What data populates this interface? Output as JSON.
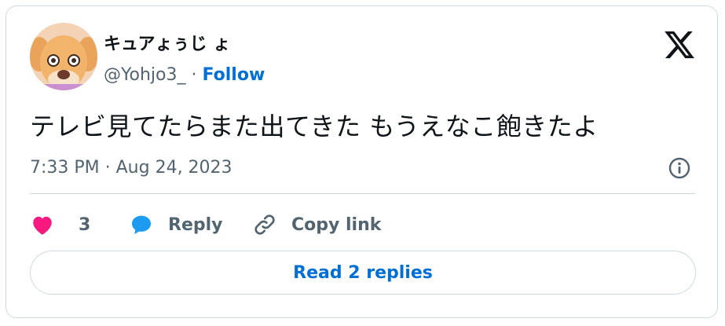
{
  "author": {
    "display_name": "キュアょぅじ ょ",
    "handle": "@Yohjo3_",
    "separator": "·",
    "follow_label": "Follow"
  },
  "tweet": {
    "text": "テレビ見てたらまた出てきた もうえなこ飽きたよ",
    "timestamp": "7:33 PM · Aug 24, 2023"
  },
  "actions": {
    "like_count": "3",
    "reply_label": "Reply",
    "copy_label": "Copy link"
  },
  "footer": {
    "read_replies_label": "Read 2 replies"
  },
  "colors": {
    "accent": "#006fd6",
    "like": "#f91880",
    "reply_icon": "#1d9bf0",
    "muted": "#536471",
    "border": "#cfd9de"
  },
  "icons": [
    "x-logo-icon",
    "info-icon",
    "heart-icon",
    "speech-bubble-icon",
    "link-icon"
  ]
}
